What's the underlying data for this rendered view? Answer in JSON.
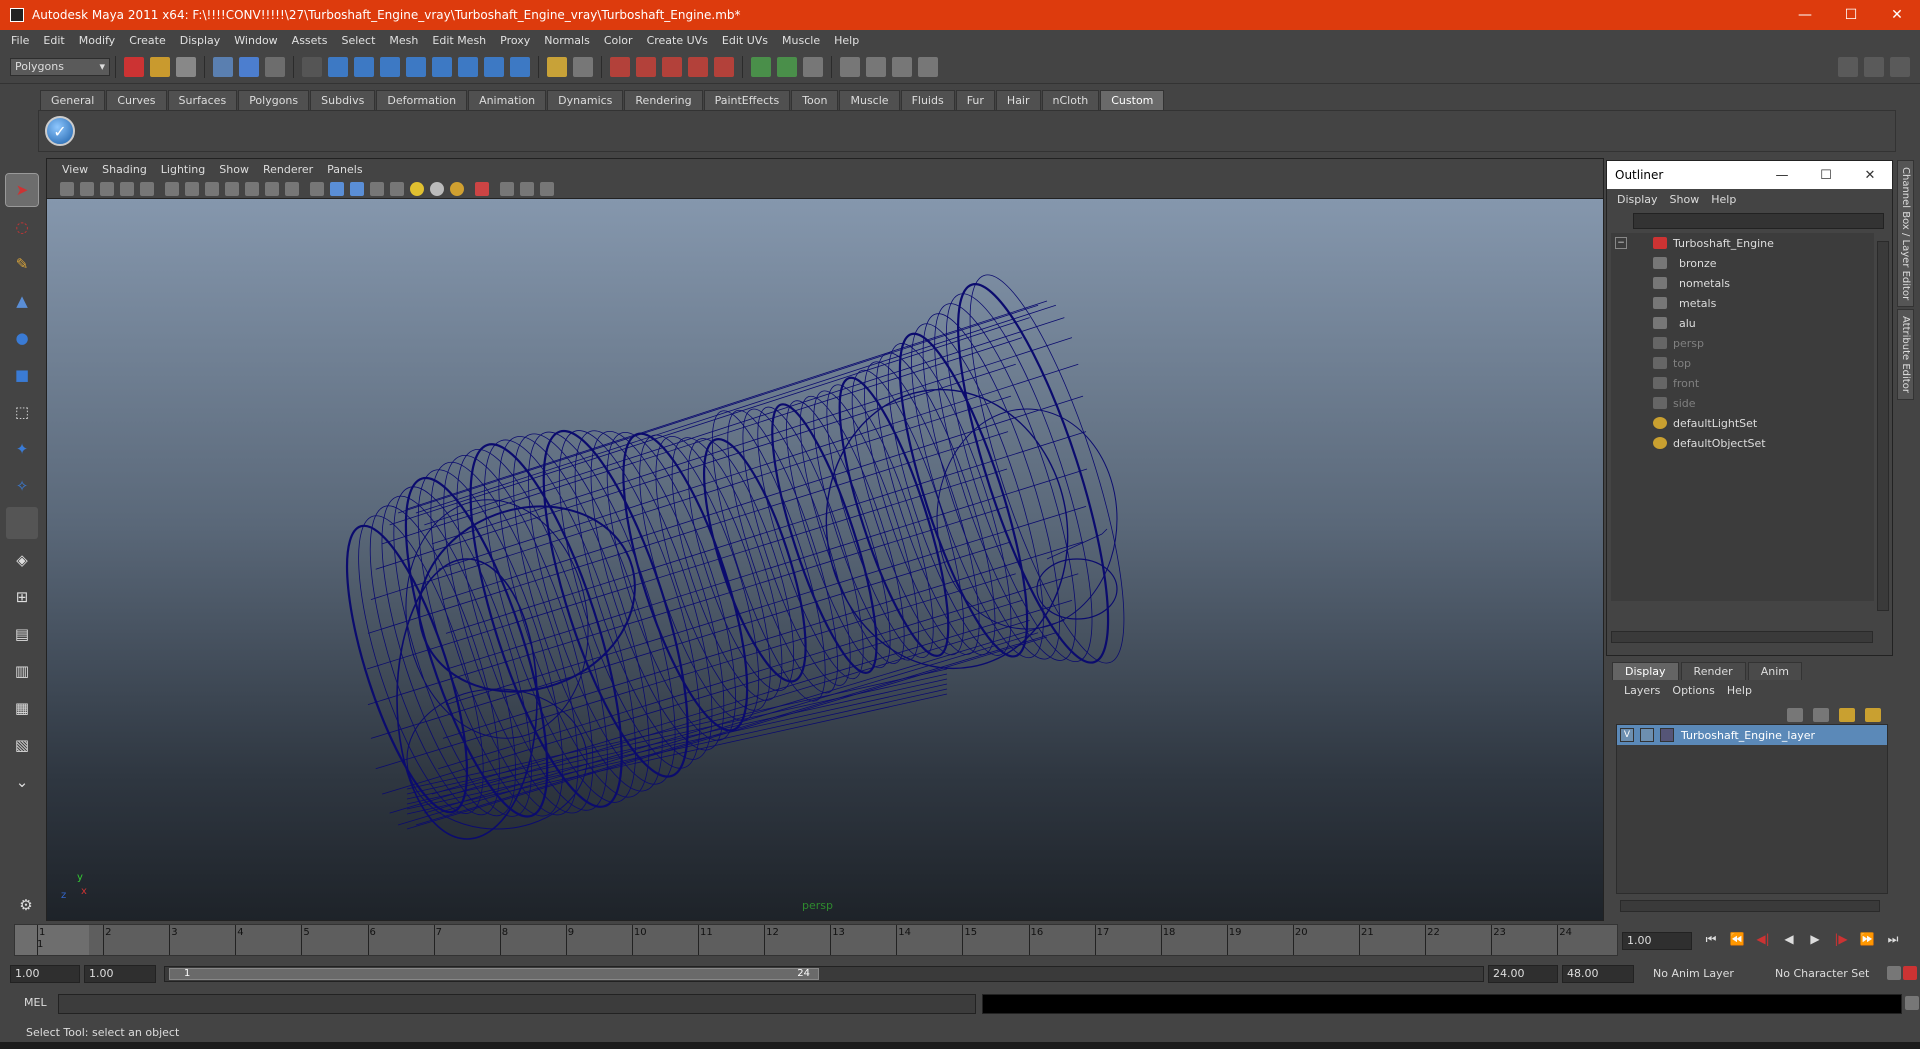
{
  "window": {
    "title": "Autodesk Maya 2011 x64: F:\\!!!!CONV!!!!!\\27\\Turboshaft_Engine_vray\\Turboshaft_Engine_vray\\Turboshaft_Engine.mb*",
    "minimize": "—",
    "maximize": "☐",
    "close": "✕"
  },
  "menu": [
    "File",
    "Edit",
    "Modify",
    "Create",
    "Display",
    "Window",
    "Assets",
    "Select",
    "Mesh",
    "Edit Mesh",
    "Proxy",
    "Normals",
    "Color",
    "Create UVs",
    "Edit UVs",
    "Muscle",
    "Help"
  ],
  "status_line": {
    "mode": "Polygons",
    "mode_arrow": "▾"
  },
  "shelf": {
    "tabs": [
      "General",
      "Curves",
      "Surfaces",
      "Polygons",
      "Subdivs",
      "Deformation",
      "Animation",
      "Dynamics",
      "Rendering",
      "PaintEffects",
      "Toon",
      "Muscle",
      "Fluids",
      "Fur",
      "Hair",
      "nCloth",
      "Custom"
    ],
    "active_tab": "Custom",
    "button_glyph": "✓"
  },
  "viewport": {
    "menu": [
      "View",
      "Shading",
      "Lighting",
      "Show",
      "Renderer",
      "Panels"
    ],
    "camera_label": "persp",
    "wire_color": "#0b0b6e",
    "axis_labels": {
      "x": "x",
      "y": "y",
      "z": "z"
    }
  },
  "outliner": {
    "title": "Outliner",
    "menu": [
      "Display",
      "Show",
      "Help"
    ],
    "collapse_glyph": "−",
    "items": [
      {
        "label": "Turboshaft_Engine",
        "dim": false
      },
      {
        "label": "bronze",
        "dim": false
      },
      {
        "label": "nometals",
        "dim": false
      },
      {
        "label": "metals",
        "dim": false
      },
      {
        "label": "alu",
        "dim": false
      },
      {
        "label": "persp",
        "dim": true
      },
      {
        "label": "top",
        "dim": true
      },
      {
        "label": "front",
        "dim": true
      },
      {
        "label": "side",
        "dim": true
      },
      {
        "label": "defaultLightSet",
        "dim": false
      },
      {
        "label": "defaultObjectSet",
        "dim": false
      }
    ]
  },
  "layer_editor": {
    "tabs": [
      "Display",
      "Render",
      "Anim"
    ],
    "active_tab": "Display",
    "menu": [
      "Layers",
      "Options",
      "Help"
    ],
    "layer_visible": "V",
    "layer_name": "Turboshaft_Engine_layer"
  },
  "side_tabs": [
    "Channel Box / Layer Editor",
    "Attribute Editor"
  ],
  "time_slider": {
    "frames": [
      "1",
      "2",
      "3",
      "4",
      "5",
      "6",
      "7",
      "8",
      "9",
      "10",
      "11",
      "12",
      "13",
      "14",
      "15",
      "16",
      "17",
      "18",
      "19",
      "20",
      "21",
      "22",
      "23",
      "24"
    ],
    "current_frame_marker": "1",
    "current_time": "1.00",
    "playback": [
      "⏮",
      "⏪",
      "◀|",
      "◀",
      "▶",
      "|▶",
      "⏩",
      "⏭"
    ]
  },
  "range_slider": {
    "start_time": "1.00",
    "playback_start": "1.00",
    "handle_start": "1",
    "handle_end": "24",
    "playback_end": "24.00",
    "end_time": "48.00",
    "anim_layer": "No Anim Layer",
    "character_set": "No Character Set"
  },
  "command_line": {
    "label": "MEL"
  },
  "help_line": "Select Tool: select an object"
}
